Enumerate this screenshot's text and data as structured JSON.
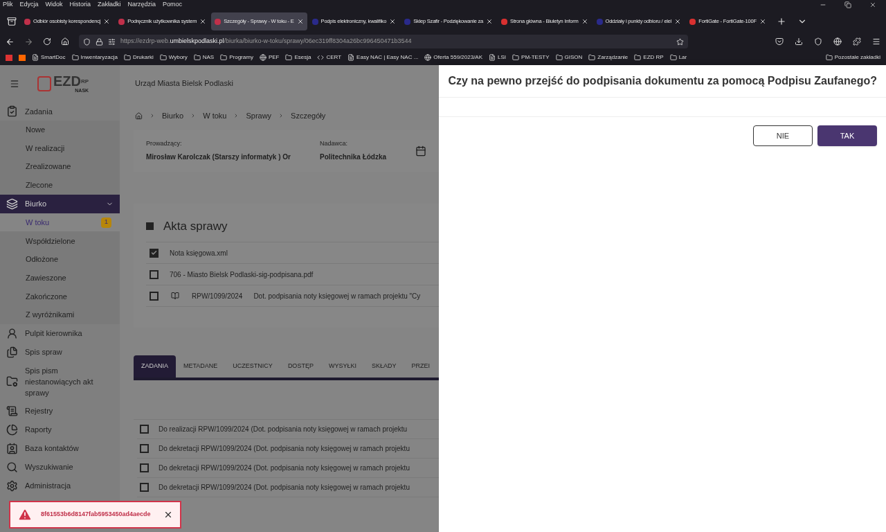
{
  "browser": {
    "menu": [
      "Plik",
      "Edycja",
      "Widok",
      "Historia",
      "Zakładki",
      "Narzędzia",
      "Pomoc"
    ],
    "tabs": [
      {
        "label": "Odbiór osobisty korespondencj",
        "selected": false,
        "color": "#c0304a"
      },
      {
        "label": "Podręcznik użytkownika system",
        "selected": false,
        "color": "#c0304a"
      },
      {
        "label": "Szczegóły - Sprawy - W toku - E",
        "selected": true,
        "color": "#c0304a"
      },
      {
        "label": "Podpis elektroniczny, kwalifiko",
        "selected": false,
        "color": "#2a2a8a"
      },
      {
        "label": "Sklep Szafir - Podziękowanie za",
        "selected": false,
        "color": "#2a2a8a"
      },
      {
        "label": "Strona główna - Biuletyn Inform",
        "selected": false,
        "color": "#d83030"
      },
      {
        "label": "Oddziały i punkty odbioru / elel",
        "selected": false,
        "color": "#2a2a8a"
      },
      {
        "label": "FortiGate - FortiGate-100F",
        "selected": false,
        "color": "#d83030"
      }
    ],
    "url": {
      "prefix": "https://ezdrp-web.",
      "domain": "umbielskpodlaski.pl",
      "path": "/biurka/biurko-w-toku/sprawy/06ec319ff8304a26bc996450471b3544"
    },
    "bookmarks": [
      {
        "label": "SmartDoc",
        "kind": "page"
      },
      {
        "label": "Inwentaryzacja",
        "kind": "folder"
      },
      {
        "label": "Drukarki",
        "kind": "folder"
      },
      {
        "label": "Wybory",
        "kind": "folder"
      },
      {
        "label": "NAS",
        "kind": "folder"
      },
      {
        "label": "Programy",
        "kind": "folder"
      },
      {
        "label": "PEF",
        "kind": "globe"
      },
      {
        "label": "Esesja",
        "kind": "folder"
      },
      {
        "label": "CERT",
        "kind": "code"
      },
      {
        "label": "Easy NAC | Easy NAC ...",
        "kind": "page"
      },
      {
        "label": "Oferta 559/2023/AK",
        "kind": "globe"
      },
      {
        "label": "LSI",
        "kind": "page"
      },
      {
        "label": "PM-TESTY",
        "kind": "folder"
      },
      {
        "label": "GISON",
        "kind": "folder"
      },
      {
        "label": "Zarządzanie",
        "kind": "folder"
      },
      {
        "label": "EZD RP",
        "kind": "folder"
      },
      {
        "label": "Lar",
        "kind": "folder"
      }
    ],
    "other_bookmarks": "Pozostałe zakładki"
  },
  "app": {
    "logo": {
      "text": "EZD",
      "sup": "RP",
      "sub": "NASK"
    },
    "org": "Urząd Miasta Bielsk Podlaski",
    "sidebar": [
      {
        "label": "Zadania",
        "expanded": true,
        "children": [
          {
            "label": "Nowe",
            "selected": false
          },
          {
            "label": "W realizacji",
            "selected": false
          },
          {
            "label": "Zrealizowane",
            "selected": false
          },
          {
            "label": "Zlecone",
            "selected": false
          }
        ]
      },
      {
        "label": "Biurko",
        "expanded": true,
        "children": [
          {
            "label": "W toku",
            "selected": true,
            "badge": "1"
          },
          {
            "label": "Współdzielone",
            "selected": false
          },
          {
            "label": "Odłożone",
            "selected": false
          },
          {
            "label": "Zawieszone",
            "selected": false
          },
          {
            "label": "Zakończone",
            "selected": false
          },
          {
            "label": "Z wyróżnikami",
            "selected": false
          }
        ]
      },
      {
        "label": "Pulpit kierownika"
      },
      {
        "label": "Spis spraw"
      },
      {
        "label": "Spis pism niestanowiących akt sprawy"
      },
      {
        "label": "Rejestry"
      },
      {
        "label": "Raporty"
      },
      {
        "label": "Baza kontaktów"
      },
      {
        "label": "Wyszukiwanie"
      },
      {
        "label": "Administracja"
      }
    ],
    "breadcrumbs": [
      "Biurko",
      "W toku",
      "Sprawy",
      "Szczegóły"
    ],
    "details": [
      {
        "label": "Prowadzący:",
        "value": "Mirosław Karolczak (Starszy informatyk ) Or"
      },
      {
        "label": "Nadawca:",
        "value": "Politechnika Łódzka"
      }
    ],
    "files": {
      "title": "Akta sprawy",
      "rows": [
        {
          "checked": true,
          "name": "Nota księgowa.xml"
        },
        {
          "checked": false,
          "name": "706 - Miasto Bielsk Podlaski-sig-podpisana.pdf"
        },
        {
          "checked": false,
          "number": "RPW/1099/2024",
          "name": "Dot. podpisania noty księgowej w ramach projektu \"Cy"
        }
      ]
    },
    "tabs": [
      {
        "label": "ZADANIA",
        "selected": true
      },
      {
        "label": "METADANE",
        "selected": false
      },
      {
        "label": "UCZESTNICY",
        "selected": false
      },
      {
        "label": "DOSTĘP",
        "selected": false
      },
      {
        "label": "WYSYŁKI",
        "selected": false
      },
      {
        "label": "SKŁADY",
        "selected": false
      },
      {
        "label": "PRZEI",
        "selected": false
      }
    ],
    "tasks": [
      {
        "checked": false,
        "text": "Do realizacji RPW/1099/2024 (Dot. podpisania noty księgowej w ramach projektu"
      },
      {
        "checked": false,
        "text": "Do dekretacji RPW/1099/2024 (Dot. podpisania noty księgowej w ramach projektu"
      },
      {
        "checked": false,
        "text": "Do dekretacji RPW/1099/2024 (Dot. podpisania noty księgowej w ramach projektu"
      },
      {
        "checked": false,
        "text": "Do dekretacji RPW/1099/2024 (Dot. podpisania noty księgowej w ramach projektu"
      }
    ],
    "toast": {
      "text": "8f61553b6d8147fab5953450ad4aecde"
    }
  },
  "dialog": {
    "title": "Czy na pewno przejść do podpisania dokumentu za pomocą Podpisu Zaufanego?",
    "buttons": [
      {
        "label": "NIE",
        "kind": "secondary"
      },
      {
        "label": "TAK",
        "kind": "primary"
      }
    ]
  }
}
